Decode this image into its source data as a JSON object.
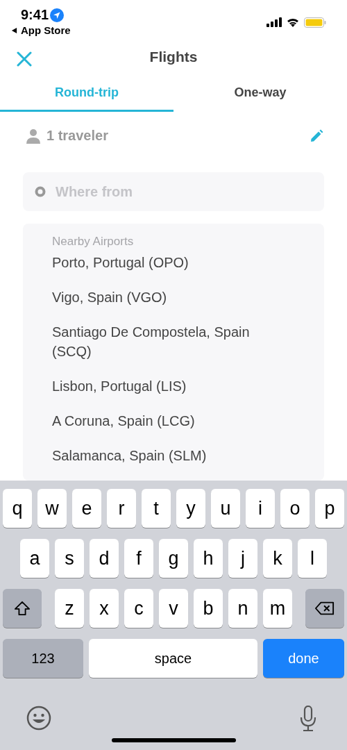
{
  "status_bar": {
    "time": "9:41",
    "back_label": "App Store"
  },
  "nav": {
    "title": "Flights"
  },
  "tabs": [
    {
      "label": "Round-trip",
      "selected": true
    },
    {
      "label": "One-way",
      "selected": false
    }
  ],
  "travelers": {
    "label": "1 traveler"
  },
  "from_field": {
    "placeholder": "Where from"
  },
  "airports": {
    "heading": "Nearby Airports",
    "items": [
      "Porto, Portugal (OPO)",
      "Vigo, Spain (VGO)",
      "Santiago De Compostela, Spain (SCQ)",
      "Lisbon, Portugal (LIS)",
      "A Coruna, Spain (LCG)",
      "Salamanca, Spain (SLM)"
    ]
  },
  "keyboard": {
    "rows": [
      [
        "q",
        "w",
        "e",
        "r",
        "t",
        "y",
        "u",
        "i",
        "o",
        "p"
      ],
      [
        "a",
        "s",
        "d",
        "f",
        "g",
        "h",
        "j",
        "k",
        "l"
      ],
      [
        "z",
        "x",
        "c",
        "v",
        "b",
        "n",
        "m"
      ]
    ],
    "numbers_key": "123",
    "space_key": "space",
    "done_key": "done"
  }
}
